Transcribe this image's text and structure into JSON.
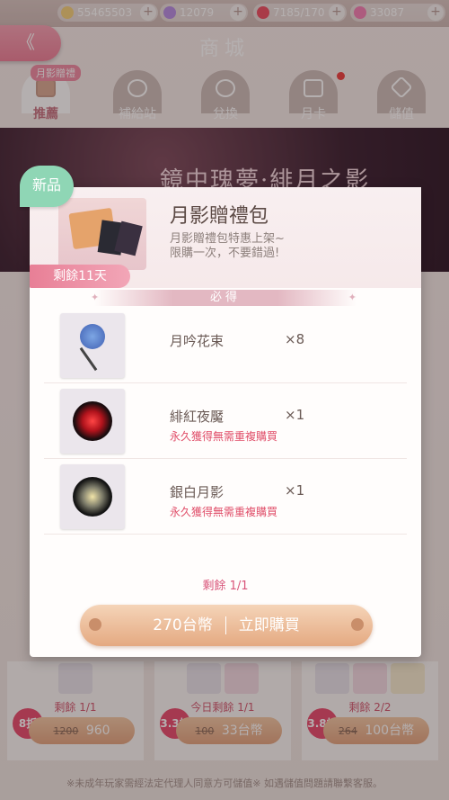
{
  "colors": {
    "accent": "#ee7f98",
    "warn": "#e04e69",
    "gold": "#e4a981",
    "new": "#8fd6b5"
  },
  "resources": [
    {
      "icon": "cat-coin-icon",
      "value": "55465503"
    },
    {
      "icon": "purple-gem-icon",
      "value": "12079"
    },
    {
      "icon": "heart-icon",
      "value": "7185/170"
    },
    {
      "icon": "pink-gem-icon",
      "value": "33087"
    }
  ],
  "header": {
    "back": "《",
    "title": "商城"
  },
  "tabs": [
    {
      "label": "推薦",
      "badge": "月影贈禮",
      "active": true
    },
    {
      "label": "補給站"
    },
    {
      "label": "兌換"
    },
    {
      "label": "月卡",
      "dot": true
    },
    {
      "label": "儲值"
    }
  ],
  "banner": {
    "title": "鏡中瑰夢·緋月之影"
  },
  "popup": {
    "new_badge": "新品",
    "remain_days": "剩餘11天",
    "title": "月影贈禮包",
    "desc_line1": "月影贈禮包特惠上架~",
    "desc_line2": "限購一次，不要錯過!",
    "must_label": "必得",
    "items": [
      {
        "name": "月吟花束",
        "qty": "×8",
        "note": ""
      },
      {
        "name": "緋紅夜魘",
        "qty": "×1",
        "note": "永久獲得無需重複購買"
      },
      {
        "name": "銀白月影",
        "qty": "×1",
        "note": "永久獲得無需重複購買"
      }
    ],
    "remain": "剩餘 1/1",
    "price": "270台幣",
    "buy_label": "立即購買"
  },
  "background_cards": [
    {
      "remain": "剩餘 1/1",
      "discount": "8折",
      "old": "1200",
      "price": "960"
    },
    {
      "remain": "今日剩餘 1/1",
      "discount": "3.3折",
      "old": "100",
      "price": "33台幣"
    },
    {
      "remain": "剩餘 2/2",
      "discount": "3.8折",
      "old": "264",
      "price": "100台幣"
    }
  ],
  "footer": "※未成年玩家需經法定代理人同意方可儲值※ 如遇儲值問題請聯繫客服。"
}
